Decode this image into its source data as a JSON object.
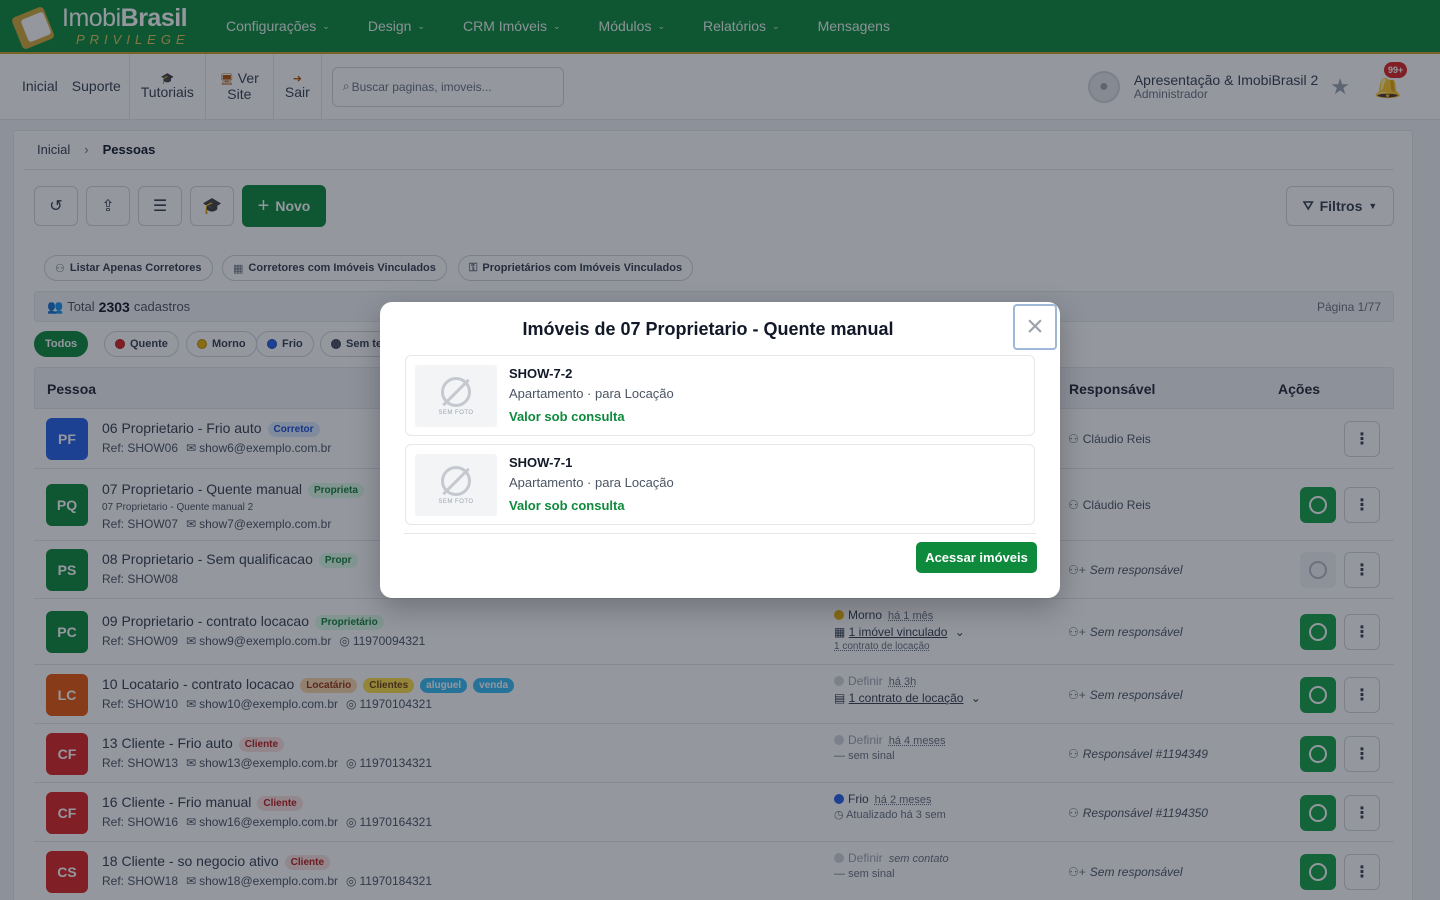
{
  "brand": {
    "name_light": "Imobi",
    "name_bold": "Brasil",
    "tagline": "PRIVILEGE"
  },
  "nav": [
    {
      "label": "Configurações",
      "has_dropdown": true
    },
    {
      "label": "Design",
      "has_dropdown": true
    },
    {
      "label": "CRM Imóveis",
      "has_dropdown": true
    },
    {
      "label": "Módulos",
      "has_dropdown": true
    },
    {
      "label": "Relatórios",
      "has_dropdown": true
    },
    {
      "label": "Mensagens",
      "has_dropdown": false
    }
  ],
  "subbar": {
    "inicial": "Inicial",
    "suporte": "Suporte",
    "tutoriais": "Tutoriais",
    "ver": "Ver",
    "site": "Site",
    "sair": "Sair",
    "search_placeholder": "Buscar paginas, imoveis..."
  },
  "user": {
    "name": "Apresentação & ImobiBrasil 2",
    "role": "Administrador",
    "notifications": "99+"
  },
  "breadcrumb": {
    "home": "Inicial",
    "current": "Pessoas"
  },
  "toolbar": {
    "novo_label": "Novo",
    "filtros_label": "Filtros"
  },
  "chips": [
    {
      "label": "Listar Apenas Corretores",
      "icon": "user-icon"
    },
    {
      "label": "Corretores com Imóveis Vinculados",
      "icon": "building-icon"
    },
    {
      "label": "Proprietários com Imóveis Vinculados",
      "icon": "key-icon"
    }
  ],
  "total": {
    "prefix": "Total",
    "count": "2303",
    "suffix": "cadastros",
    "page": "Página 1/77"
  },
  "segments": [
    {
      "label": "Todos",
      "color": null,
      "active": true
    },
    {
      "label": "Quente",
      "color": "#dc2626",
      "active": false
    },
    {
      "label": "Morno",
      "color": "#eab308",
      "active": false
    },
    {
      "label": "Frio",
      "color": "#2563eb",
      "active": false
    },
    {
      "label": "Sem te",
      "color": "#4b5563",
      "active": false
    }
  ],
  "table": {
    "headers": {
      "pessoa": "Pessoa",
      "responsavel": "Responsável",
      "acoes": "Ações"
    },
    "rows": [
      {
        "initials": "PF",
        "color": "#2563eb",
        "name": "06 Proprietario - Frio auto",
        "tags": [
          {
            "t": "Corretor",
            "bg": "#dbeafe",
            "fg": "#1d4ed8"
          }
        ],
        "ref": "Ref: SHOW06",
        "email": "show6@exemplo.com.br",
        "phone": "",
        "extra": "",
        "responsavel": "Cláudio Reis",
        "resp_italic": false,
        "wa": "none"
      },
      {
        "initials": "PQ",
        "color": "#0e8a3c",
        "name": "07 Proprietario - Quente manual",
        "tags": [
          {
            "t": "Proprieta",
            "bg": "#dcfce7",
            "fg": "#15803d"
          }
        ],
        "ref": "Ref: SHOW07",
        "email": "show7@exemplo.com.br",
        "phone": "",
        "extra": "07 Proprietario - Quente manual 2",
        "responsavel": "Cláudio Reis",
        "resp_italic": false,
        "wa": "on"
      },
      {
        "initials": "PS",
        "color": "#0e8a3c",
        "name": "08 Proprietario - Sem qualificacao",
        "tags": [
          {
            "t": "Propr",
            "bg": "#dcfce7",
            "fg": "#15803d"
          }
        ],
        "ref": "Ref: SHOW08",
        "email": "",
        "phone": "",
        "extra": "",
        "responsavel": "Sem responsável",
        "resp_italic": true,
        "wa": "off"
      },
      {
        "initials": "PC",
        "color": "#0e8a3c",
        "name": "09 Proprietario - contrato locacao",
        "tags": [
          {
            "t": "Proprietário",
            "bg": "#dcfce7",
            "fg": "#15803d"
          }
        ],
        "ref": "Ref: SHOW09",
        "email": "show9@exemplo.com.br",
        "phone": "11970094321",
        "extra": "",
        "responsavel": "Sem responsável",
        "resp_italic": true,
        "wa": "on"
      },
      {
        "initials": "LC",
        "color": "#ea580c",
        "name": "10 Locatario - contrato locacao",
        "tags": [
          {
            "t": "Locatário",
            "bg": "#fed7aa",
            "fg": "#9a3412"
          },
          {
            "t": "Clientes",
            "bg": "#fde047",
            "fg": "#713f12"
          },
          {
            "t": "aluguel",
            "bg": "#38bdf8",
            "fg": "#ffffff"
          },
          {
            "t": "venda",
            "bg": "#38bdf8",
            "fg": "#ffffff"
          }
        ],
        "ref": "Ref: SHOW10",
        "email": "show10@exemplo.com.br",
        "phone": "11970104321",
        "extra": "",
        "responsavel": "Sem responsável",
        "resp_italic": true,
        "wa": "on"
      },
      {
        "initials": "CF",
        "color": "#dc2626",
        "name": "13 Cliente - Frio auto",
        "tags": [
          {
            "t": "Cliente",
            "bg": "#fee2e2",
            "fg": "#b91c1c"
          }
        ],
        "ref": "Ref: SHOW13",
        "email": "show13@exemplo.com.br",
        "phone": "11970134321",
        "extra": "",
        "responsavel": "Responsável #1194349",
        "resp_italic": true,
        "wa": "on"
      },
      {
        "initials": "CF",
        "color": "#dc2626",
        "name": "16 Cliente - Frio manual",
        "tags": [
          {
            "t": "Cliente",
            "bg": "#fee2e2",
            "fg": "#b91c1c"
          }
        ],
        "ref": "Ref: SHOW16",
        "email": "show16@exemplo.com.br",
        "phone": "11970164321",
        "extra": "",
        "responsavel": "Responsável #1194350",
        "resp_italic": true,
        "wa": "on"
      },
      {
        "initials": "CS",
        "color": "#dc2626",
        "name": "18 Cliente - so negocio ativo",
        "tags": [
          {
            "t": "Cliente",
            "bg": "#fee2e2",
            "fg": "#b91c1c"
          }
        ],
        "ref": "Ref: SHOW18",
        "email": "show18@exemplo.com.br",
        "phone": "11970184321",
        "extra": "",
        "responsavel": "Sem responsável",
        "resp_italic": true,
        "wa": "on"
      }
    ],
    "status": [
      {
        "row": 3,
        "label": "Morno",
        "dot": "#eab308",
        "ago": "há 1 mês",
        "line2": "1 imóvel vinculado",
        "line2_icon": "building-icon",
        "line3": "1 contrato de locação"
      },
      {
        "row": 4,
        "label": "Definir",
        "dot": "#d1d5db",
        "ago": "há 3h",
        "line2": "1 contrato de locação",
        "line2_icon": "document-icon",
        "line3": ""
      },
      {
        "row": 5,
        "label": "Definir",
        "dot": "#d1d5db",
        "ago": "há 4 meses",
        "line2": "sem sinal",
        "line2_icon": "dash-icon",
        "line3": ""
      },
      {
        "row": 6,
        "label": "Frio",
        "dot": "#2563eb",
        "ago": "há 2 meses",
        "line2": "Atualizado há 3 sem",
        "line2_icon": "clock-icon",
        "line3": ""
      },
      {
        "row": 7,
        "label": "Definir",
        "dot": "#d1d5db",
        "ago": "sem contato",
        "line2": "sem sinal",
        "line2_icon": "dash-icon",
        "line3": ""
      }
    ]
  },
  "modal": {
    "title": "Imóveis de 07 Proprietario - Quente manual",
    "properties": [
      {
        "code": "SHOW-7-2",
        "type": "Apartamento · para Locação",
        "price": "Valor sob consulta",
        "photo_label": "SEM FOTO"
      },
      {
        "code": "SHOW-7-1",
        "type": "Apartamento · para Locação",
        "price": "Valor sob consulta",
        "photo_label": "SEM FOTO"
      }
    ],
    "button": "Acessar imóveis"
  }
}
